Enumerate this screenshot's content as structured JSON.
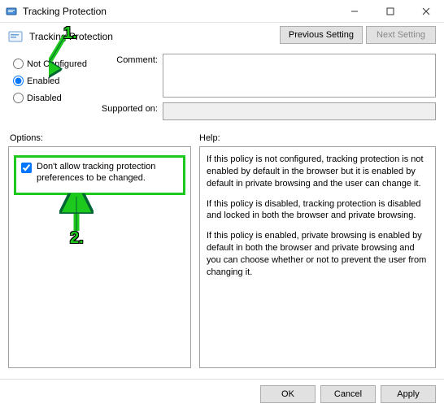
{
  "window": {
    "title": "Tracking Protection"
  },
  "header": {
    "title": "Tracking Protection"
  },
  "buttons": {
    "previous": "Previous Setting",
    "next": "Next Setting",
    "ok": "OK",
    "cancel": "Cancel",
    "apply": "Apply"
  },
  "radios": {
    "not_configured": "Not Configured",
    "enabled": "Enabled",
    "disabled": "Disabled",
    "selected": "enabled"
  },
  "labels": {
    "comment": "Comment:",
    "supported": "Supported on:",
    "options": "Options:",
    "help": "Help:"
  },
  "options": {
    "checkbox_label": "Don't allow tracking protection preferences to be changed.",
    "checked": true
  },
  "help": {
    "p1": "If this policy is not configured, tracking protection is not enabled by default in the browser but it is enabled by default in private browsing and the user can change it.",
    "p2": "If this policy is disabled, tracking protection is disabled and locked in both the browser and private browsing.",
    "p3": "If this policy is enabled, private browsing is enabled by default in both the browser and private browsing and you can choose whether or not to prevent the user from changing it."
  },
  "annotations": {
    "one": "1.",
    "two": "2."
  }
}
